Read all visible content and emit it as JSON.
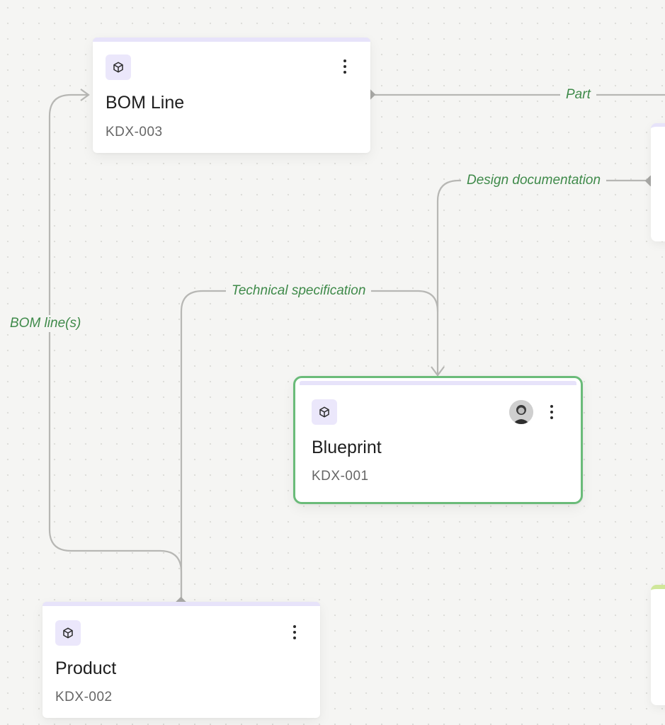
{
  "nodes": {
    "bom_line": {
      "title": "BOM Line",
      "id": "KDX-003"
    },
    "blueprint": {
      "title": "Blueprint",
      "id": "KDX-001"
    },
    "product": {
      "title": "Product",
      "id": "KDX-002"
    }
  },
  "edges": {
    "part": "Part",
    "design_documentation": "Design documentation",
    "technical_specification": "Technical specification",
    "bom_lines": "BOM line(s)"
  },
  "colors": {
    "accent_purple": "#e7e3fa",
    "icon_bg": "#ebe7fb",
    "selected_border": "#6abb79",
    "edge_label": "#3f8a4a",
    "edge_line": "#b7b7b4",
    "partial_green_accent": "#cfe79a"
  },
  "icons": {
    "node_type": "cube-icon",
    "menu": "more-vertical-icon",
    "avatar": "user-avatar"
  }
}
